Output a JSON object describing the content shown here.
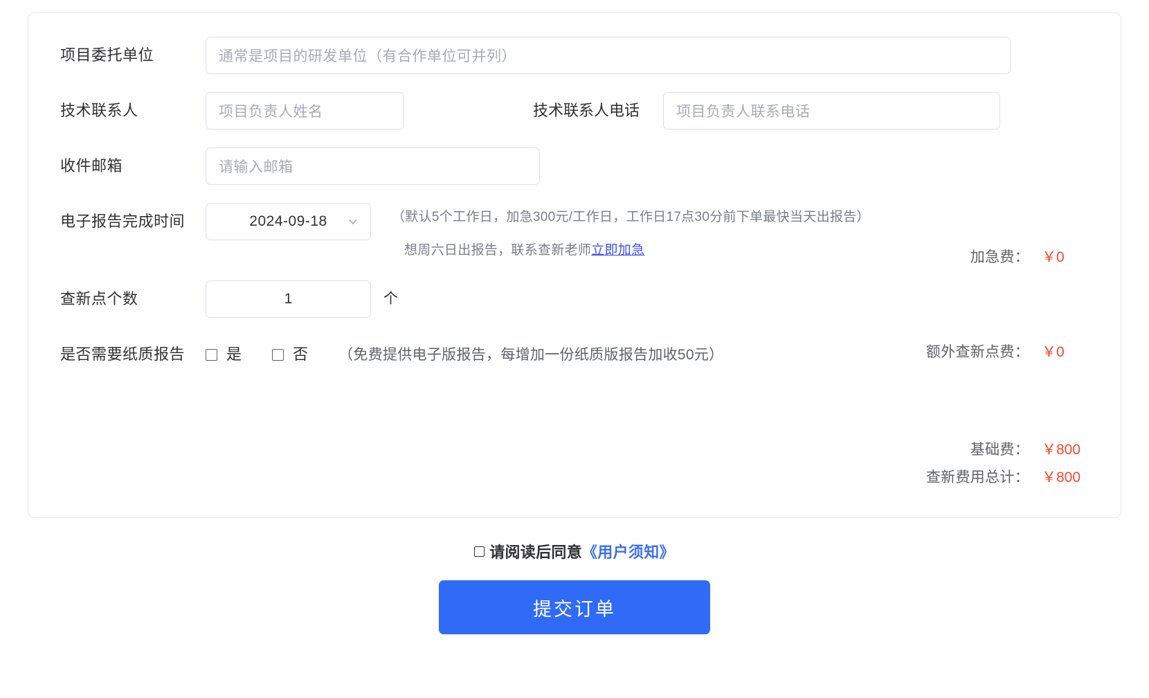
{
  "form": {
    "client_unit": {
      "label": "项目委托单位",
      "placeholder": "通常是项目的研发单位（有合作单位可并列）",
      "value": ""
    },
    "tech_contact": {
      "label": "技术联系人",
      "placeholder": "项目负责人姓名",
      "value": ""
    },
    "tech_phone": {
      "label": "技术联系人电话",
      "placeholder": "项目负责人联系电话",
      "value": ""
    },
    "email": {
      "label": "收件邮箱",
      "placeholder": "请输入邮箱",
      "value": ""
    },
    "report_date": {
      "label": "电子报告完成时间",
      "value": "2024-09-18",
      "chevron_icon": "chevron-down-icon"
    },
    "report_note_line1": "（默认5个工作日，加急300元/工作日，工作日17点30分前下单最快当天出报告）",
    "report_note_line2_prefix": "想周六日出报告，联系查新老师",
    "report_note_line2_link": "立即加急",
    "novelty_points": {
      "label": "查新点个数",
      "value": "1",
      "unit": "个"
    },
    "paper_report": {
      "label": "是否需要纸质报告",
      "option_yes": "是",
      "option_no": "否",
      "note": "（免费提供电子版报告，每增加一份纸质版报告加收50元）"
    }
  },
  "prices": {
    "rush_label": "加急费：",
    "rush_value": "￥0",
    "extra_label": "额外查新点费：",
    "extra_value": "￥0",
    "base_label": "基础费：",
    "base_value": "￥800",
    "total_label": "查新费用总计：",
    "total_value": "￥800",
    "accent_color": "#f5492e"
  },
  "footer": {
    "agree_text": "请阅读后同意",
    "agree_link": "《用户须知》",
    "submit_label": "提交订单",
    "submit_color": "#2f6bf7",
    "link_color": "#3b6ef0"
  }
}
